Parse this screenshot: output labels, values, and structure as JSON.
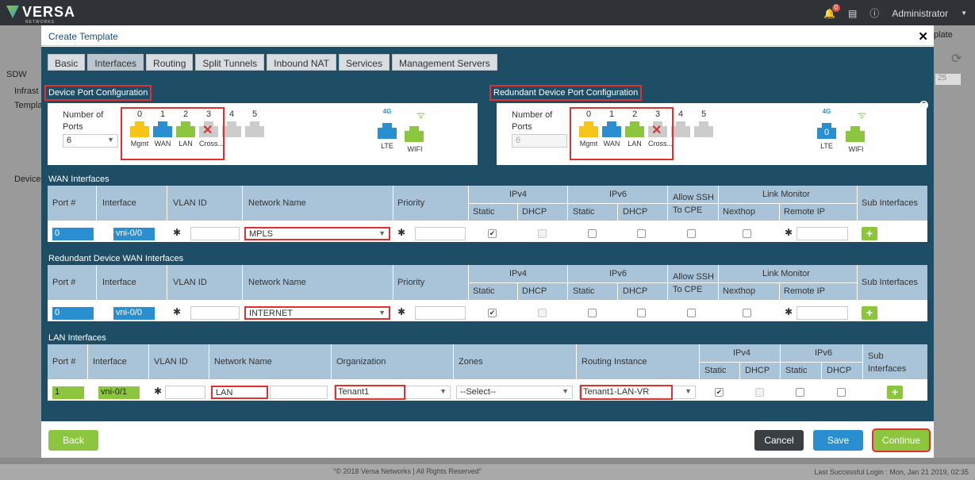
{
  "app": {
    "logo": "VERSA",
    "logo_sub": "NETWORKS",
    "notif_count": "0",
    "user": "Administrator"
  },
  "background": {
    "left_items": [
      "SDW",
      "Infrast",
      "Templa",
      "Device"
    ],
    "right_label": "plate",
    "right_select": "25"
  },
  "footer": {
    "copyright": "\"© 2018 Versa Networks | All Rights Reserved\"",
    "last_login": "Last Successful Login : Mon, Jan 21 2019, 02:35"
  },
  "modal": {
    "title": "Create Template",
    "tabs": [
      "Basic",
      "Interfaces",
      "Routing",
      "Split Tunnels",
      "Inbound NAT",
      "Services",
      "Management Servers"
    ],
    "active_tab": "Interfaces"
  },
  "device_port": {
    "title": "Device Port Configuration",
    "num_ports_label": "Number of Ports",
    "num_ports_value": "6",
    "ports": [
      {
        "num": "0",
        "label": "Mgmt",
        "color": "#f5c518"
      },
      {
        "num": "1",
        "label": "WAN",
        "color": "#2a8fd0"
      },
      {
        "num": "2",
        "label": "LAN",
        "color": "#8cc63f"
      },
      {
        "num": "3",
        "label": "Cross...",
        "color": "#cccccc"
      },
      {
        "num": "4",
        "label": "",
        "color": "#cccccc"
      },
      {
        "num": "5",
        "label": "",
        "color": "#cccccc"
      }
    ],
    "lte_label": "LTE",
    "lte_badge": "4G",
    "wifi_label": "WIFI"
  },
  "redundant_port": {
    "title": "Redundant Device Port Configuration",
    "num_ports_label": "Number of Ports",
    "num_ports_value": "6",
    "lte_label": "LTE",
    "lte_badge": "4G",
    "lte_num": "0",
    "wifi_label": "WIFI"
  },
  "wan": {
    "title": "WAN Interfaces",
    "headers": {
      "port": "Port #",
      "interface": "Interface",
      "vlan": "VLAN ID",
      "network": "Network Name",
      "priority": "Priority",
      "ipv4": "IPv4",
      "ipv6": "IPv6",
      "static": "Static",
      "dhcp": "DHCP",
      "ssh": "Allow SSH To CPE",
      "link": "Link Monitor",
      "nexthop": "Nexthop",
      "remote": "Remote IP",
      "sub": "Sub Interfaces"
    },
    "row": {
      "port": "0",
      "interface": "vni-0/0",
      "network": "MPLS"
    }
  },
  "rwan": {
    "title": "Redundant Device WAN Interfaces",
    "row": {
      "port": "0",
      "interface": "vni-0/0",
      "network": "INTERNET"
    }
  },
  "lan": {
    "title": "LAN Interfaces",
    "headers": {
      "port": "Port #",
      "interface": "Interface",
      "vlan": "VLAN ID",
      "network": "Network Name",
      "org": "Organization",
      "zones": "Zones",
      "routing": "Routing Instance",
      "ipv4": "IPv4",
      "ipv6": "IPv6",
      "static": "Static",
      "dhcp": "DHCP",
      "sub": "Sub Interfaces"
    },
    "row": {
      "port": "1",
      "interface": "vni-0/1",
      "network": "LAN",
      "org": "Tenant1",
      "zones": "--Select--",
      "routing": "Tenant1-LAN-VR"
    }
  },
  "buttons": {
    "back": "Back",
    "cancel": "Cancel",
    "save": "Save",
    "continue": "Continue"
  },
  "colors": {
    "accent_green": "#8cc63f",
    "dark_blue": "#1e4d66",
    "header_blue": "#a9c4d8",
    "highlight_red": "#e03030",
    "save_blue": "#2a8fd0"
  }
}
